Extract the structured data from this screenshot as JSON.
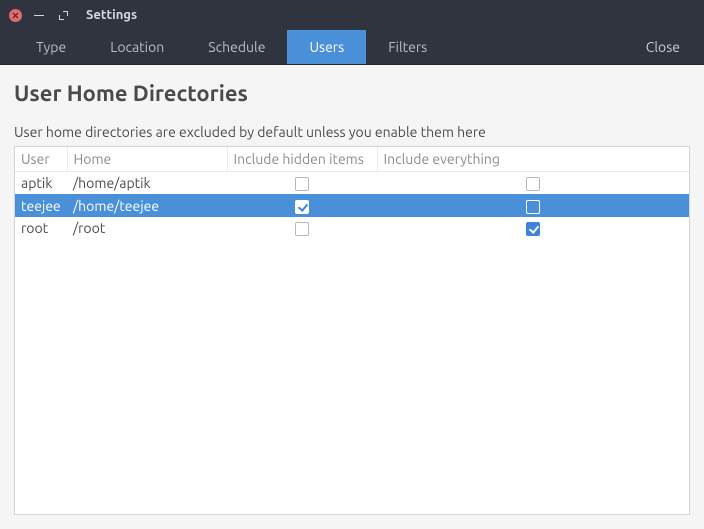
{
  "window": {
    "title": "Settings"
  },
  "toolbar": {
    "tabs": [
      {
        "label": "Type",
        "active": false
      },
      {
        "label": "Location",
        "active": false
      },
      {
        "label": "Schedule",
        "active": false
      },
      {
        "label": "Users",
        "active": true
      },
      {
        "label": "Filters",
        "active": false
      }
    ],
    "close_label": "Close"
  },
  "page": {
    "title": "User Home Directories",
    "description": "User home directories are excluded by default unless you enable them here"
  },
  "table": {
    "headers": {
      "user": "User",
      "home": "Home",
      "include_hidden": "Include hidden items",
      "include_everything": "Include everything"
    },
    "rows": [
      {
        "user": "aptik",
        "home": "/home/aptik",
        "include_hidden": false,
        "include_everything": false,
        "selected": false
      },
      {
        "user": "teejee",
        "home": "/home/teejee",
        "include_hidden": true,
        "include_everything": false,
        "selected": true
      },
      {
        "user": "root",
        "home": "/root",
        "include_hidden": false,
        "include_everything": true,
        "selected": false
      }
    ]
  }
}
